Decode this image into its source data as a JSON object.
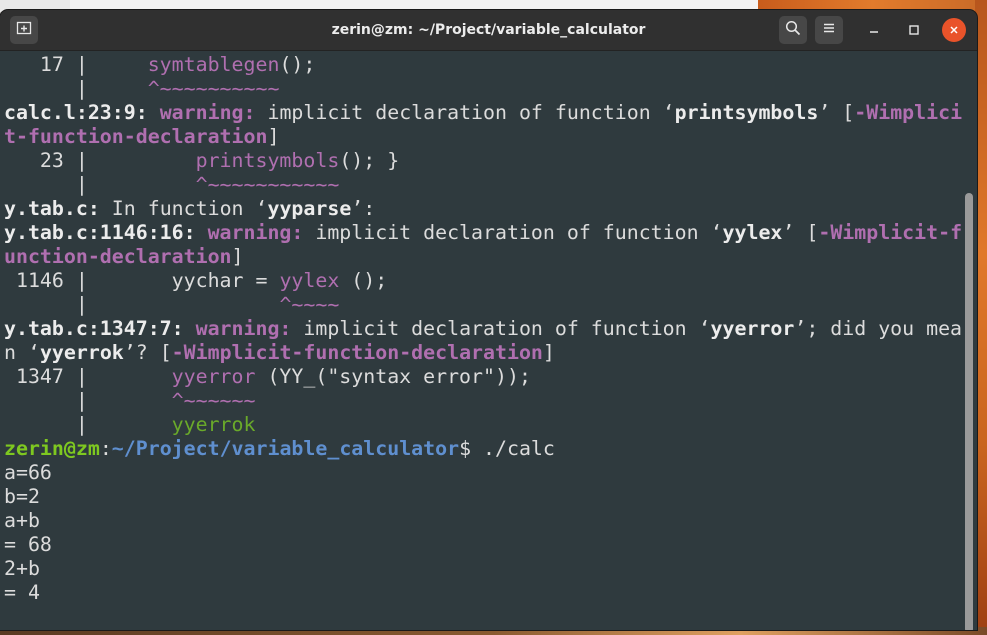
{
  "window": {
    "title": "zerin@zm: ~/Project/variable_calculator"
  },
  "icons": {
    "new_tab": "new-tab-icon",
    "search": "search-icon",
    "menu": "hamburger-menu-icon",
    "minimize": "minimize-icon",
    "maximize": "maximize-icon",
    "close": "close-icon"
  },
  "colors": {
    "terminal_bg": "#2f3a3e",
    "warning": "#b06fb0",
    "prompt_user": "#7ec820",
    "prompt_path": "#5f8fcf",
    "close_button": "#e9532a"
  },
  "terminal": {
    "lines": [
      [
        {
          "t": "   17 |     ",
          "c": ""
        },
        {
          "t": "symtablegen",
          "c": "m"
        },
        {
          "t": "();",
          "c": ""
        }
      ],
      [
        {
          "t": "      |     ",
          "c": ""
        },
        {
          "t": "^~~~~~~~~~~",
          "c": "m"
        }
      ],
      [
        {
          "t": "calc.l:23:9: ",
          "c": "b"
        },
        {
          "t": "warning: ",
          "c": "w"
        },
        {
          "t": "implicit declaration of function ‘",
          "c": ""
        },
        {
          "t": "printsymbols",
          "c": "b"
        },
        {
          "t": "’ [",
          "c": ""
        },
        {
          "t": "-Wimplici",
          "c": "mb"
        }
      ],
      [
        {
          "t": "t-function-declaration",
          "c": "mb"
        },
        {
          "t": "]",
          "c": ""
        }
      ],
      [
        {
          "t": "   23 |         ",
          "c": ""
        },
        {
          "t": "printsymbols",
          "c": "m"
        },
        {
          "t": "(); }",
          "c": ""
        }
      ],
      [
        {
          "t": "      |         ",
          "c": ""
        },
        {
          "t": "^~~~~~~~~~~~",
          "c": "m"
        }
      ],
      [
        {
          "t": "y.tab.c:",
          "c": "b"
        },
        {
          "t": " In function ‘",
          "c": ""
        },
        {
          "t": "yyparse",
          "c": "b"
        },
        {
          "t": "’:",
          "c": ""
        }
      ],
      [
        {
          "t": "y.tab.c:1146:16: ",
          "c": "b"
        },
        {
          "t": "warning: ",
          "c": "w"
        },
        {
          "t": "implicit declaration of function ‘",
          "c": ""
        },
        {
          "t": "yylex",
          "c": "b"
        },
        {
          "t": "’ [",
          "c": ""
        },
        {
          "t": "-Wimplicit-f",
          "c": "mb"
        }
      ],
      [
        {
          "t": "unction-declaration",
          "c": "mb"
        },
        {
          "t": "]",
          "c": ""
        }
      ],
      [
        {
          "t": " 1146 |       yychar = ",
          "c": ""
        },
        {
          "t": "yylex",
          "c": "m"
        },
        {
          "t": " ();",
          "c": ""
        }
      ],
      [
        {
          "t": "      |                ",
          "c": ""
        },
        {
          "t": "^~~~~",
          "c": "m"
        }
      ],
      [
        {
          "t": "y.tab.c:1347:7: ",
          "c": "b"
        },
        {
          "t": "warning: ",
          "c": "w"
        },
        {
          "t": "implicit declaration of function ‘",
          "c": ""
        },
        {
          "t": "yyerror",
          "c": "b"
        },
        {
          "t": "’; did you mea",
          "c": ""
        }
      ],
      [
        {
          "t": "n ‘",
          "c": ""
        },
        {
          "t": "yyerrok",
          "c": "b"
        },
        {
          "t": "’? [",
          "c": ""
        },
        {
          "t": "-Wimplicit-function-declaration",
          "c": "mb"
        },
        {
          "t": "]",
          "c": ""
        }
      ],
      [
        {
          "t": " 1347 |       ",
          "c": ""
        },
        {
          "t": "yyerror",
          "c": "m"
        },
        {
          "t": " (YY_(\"syntax error\"));",
          "c": ""
        }
      ],
      [
        {
          "t": "      |       ",
          "c": ""
        },
        {
          "t": "^~~~~~~",
          "c": "m"
        }
      ],
      [
        {
          "t": "      |       ",
          "c": ""
        },
        {
          "t": "yyerrok",
          "c": "g"
        }
      ],
      [
        {
          "t": "zerin@zm",
          "c": "gp"
        },
        {
          "t": ":",
          "c": ""
        },
        {
          "t": "~/Project/variable_calculator",
          "c": "bp"
        },
        {
          "t": "$ ./calc",
          "c": ""
        }
      ],
      [
        {
          "t": "a=66",
          "c": ""
        }
      ],
      [
        {
          "t": "b=2",
          "c": ""
        }
      ],
      [
        {
          "t": "a+b",
          "c": ""
        }
      ],
      [
        {
          "t": "= 68",
          "c": ""
        }
      ],
      [
        {
          "t": "2+b",
          "c": ""
        }
      ],
      [
        {
          "t": "= 4",
          "c": ""
        }
      ]
    ]
  }
}
